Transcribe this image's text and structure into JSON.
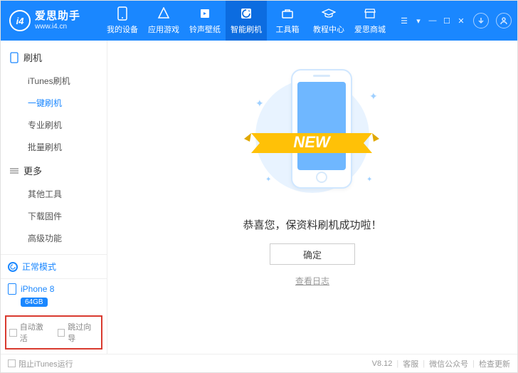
{
  "brand": {
    "name": "爱思助手",
    "url": "www.i4.cn",
    "logo": "i4"
  },
  "nav": [
    {
      "label": "我的设备",
      "icon": "device"
    },
    {
      "label": "应用游戏",
      "icon": "apps"
    },
    {
      "label": "铃声壁纸",
      "icon": "ringtone"
    },
    {
      "label": "智能刷机",
      "icon": "flash",
      "active": true
    },
    {
      "label": "工具箱",
      "icon": "tools"
    },
    {
      "label": "教程中心",
      "icon": "tutorial"
    },
    {
      "label": "爱思商城",
      "icon": "store"
    }
  ],
  "sidebar": {
    "sections": [
      {
        "title": "刷机",
        "icon": "device",
        "items": [
          {
            "label": "iTunes刷机"
          },
          {
            "label": "一键刷机",
            "active": true
          },
          {
            "label": "专业刷机"
          },
          {
            "label": "批量刷机"
          }
        ]
      },
      {
        "title": "更多",
        "icon": "more",
        "items": [
          {
            "label": "其他工具"
          },
          {
            "label": "下载固件"
          },
          {
            "label": "高级功能"
          }
        ]
      }
    ],
    "status": "正常模式",
    "device": {
      "name": "iPhone 8",
      "storage": "64GB"
    },
    "checks": [
      {
        "label": "自动激活"
      },
      {
        "label": "跳过向导"
      }
    ]
  },
  "main": {
    "ribbon": "NEW",
    "message": "恭喜您，保资料刷机成功啦！",
    "ok": "确定",
    "log": "查看日志"
  },
  "footer": {
    "block_itunes": "阻止iTunes运行",
    "version": "V8.12",
    "links": [
      "客服",
      "微信公众号",
      "检查更新"
    ]
  }
}
